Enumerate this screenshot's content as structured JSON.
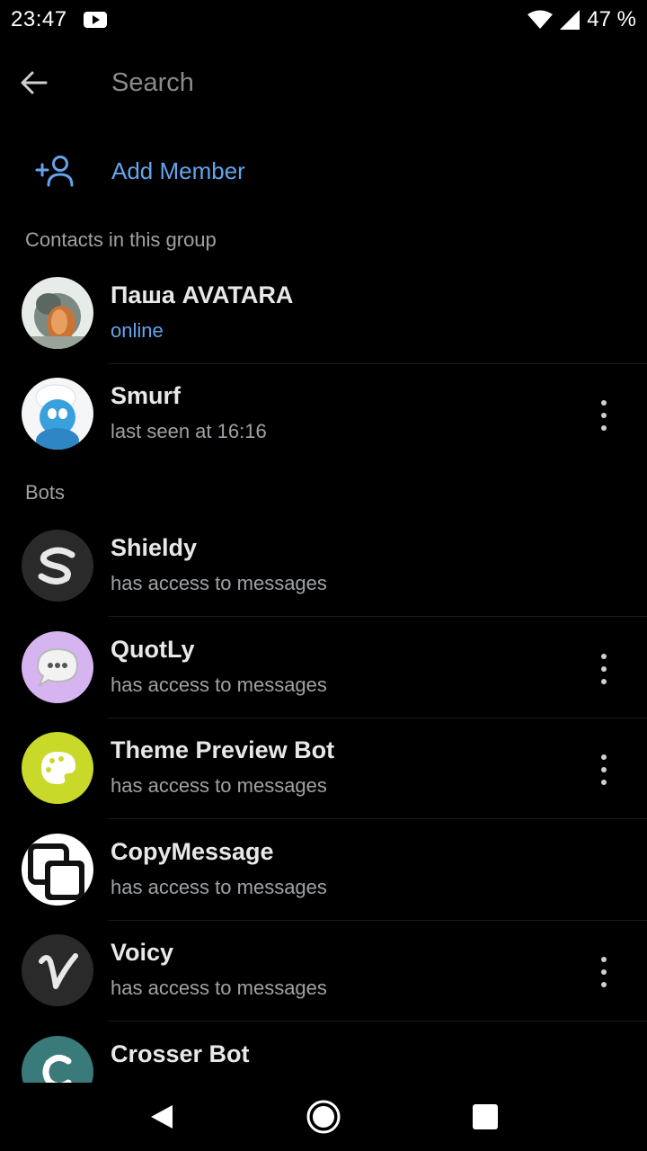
{
  "status_bar": {
    "time": "23:47",
    "battery": "47 %"
  },
  "toolbar": {
    "search_placeholder": "Search"
  },
  "add_member": {
    "label": "Add Member"
  },
  "sections": {
    "contacts": "Contacts in this group",
    "bots": "Bots"
  },
  "contacts": [
    {
      "name": "Паша AVATARA",
      "status": "online"
    },
    {
      "name": "Smurf",
      "status": "last seen at 16:16"
    }
  ],
  "bots": [
    {
      "name": "Shieldy",
      "status": "has access to messages"
    },
    {
      "name": "QuotLy",
      "status": "has access to messages"
    },
    {
      "name": "Theme Preview Bot",
      "status": "has access to messages"
    },
    {
      "name": "CopyMessage",
      "status": "has access to messages"
    },
    {
      "name": "Voicy",
      "status": "has access to messages"
    },
    {
      "name": "Crosser Bot",
      "status": ""
    }
  ],
  "colors": {
    "accent": "#64a4ec",
    "secondary_text": "#9ea2a6",
    "background": "#000000"
  }
}
